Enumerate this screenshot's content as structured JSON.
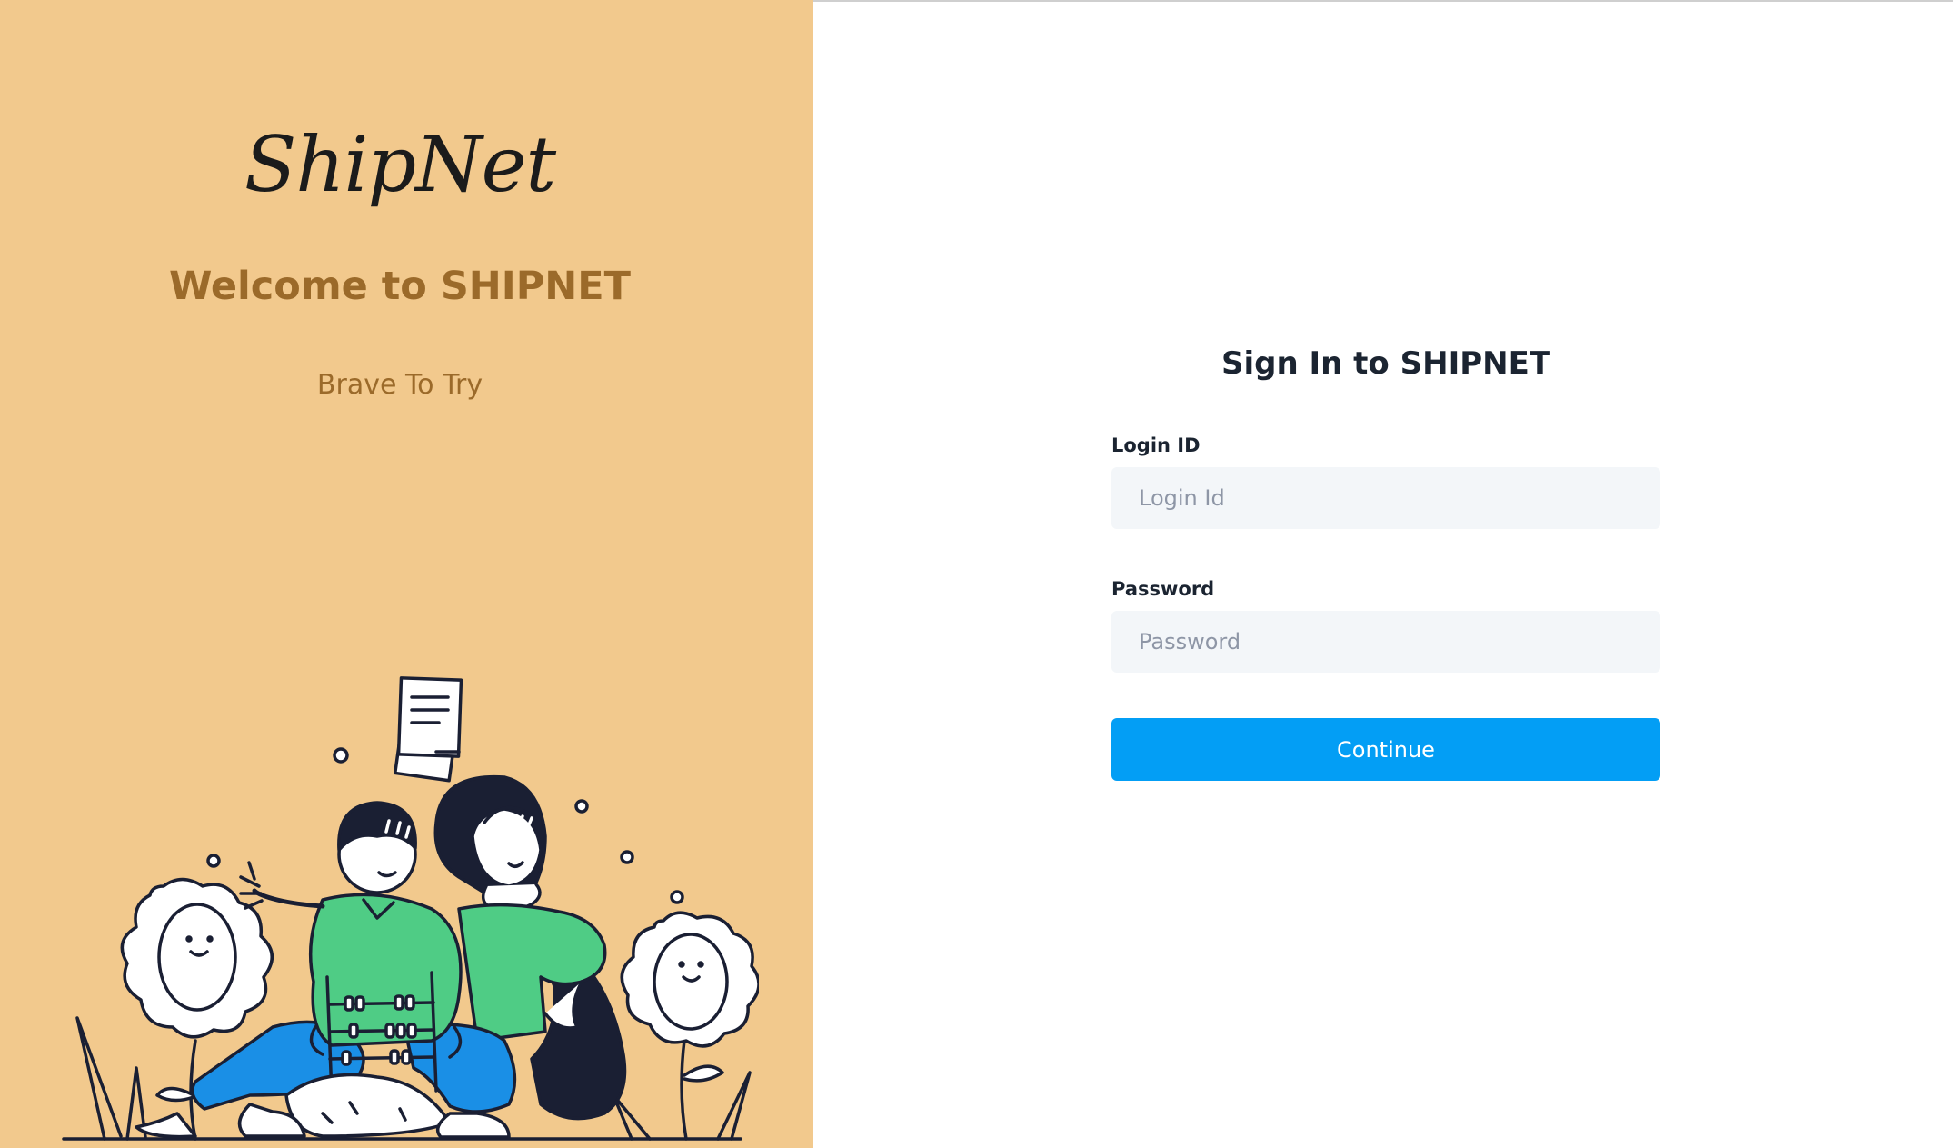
{
  "brand": {
    "logo_text": "ShipNet",
    "welcome": "Welcome to SHIPNET",
    "tagline": "Brave To Try",
    "panel_color": "#f2c98d",
    "accent_color": "#9b6a2a"
  },
  "form": {
    "title": "Sign In to SHIPNET",
    "login_label": "Login ID",
    "login_placeholder": "Login Id",
    "login_value": "",
    "password_label": "Password",
    "password_placeholder": "Password",
    "password_value": "",
    "continue_label": "Continue",
    "button_color": "#039ef5"
  }
}
